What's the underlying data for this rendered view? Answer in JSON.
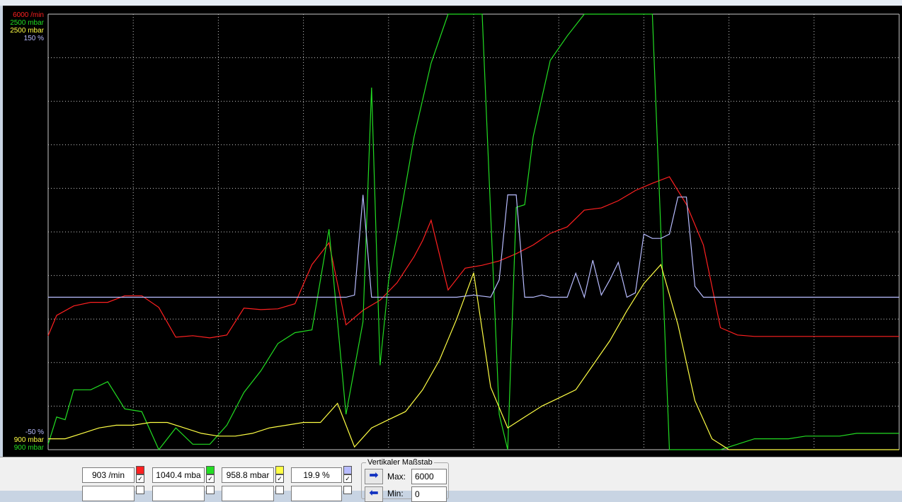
{
  "colors": {
    "rpm": "#ff2020",
    "boost": "#22dd22",
    "pressure2": "#ffff44",
    "percent": "#b8bcff",
    "grid": "#c8c8c8",
    "background": "#000000"
  },
  "scale_labels": {
    "top": [
      {
        "text": "6000 /min",
        "color": "#ff2020"
      },
      {
        "text": "2500 mbar",
        "color": "#22dd22"
      },
      {
        "text": "2500 mbar",
        "color": "#ffff44"
      },
      {
        "text": "150 %",
        "color": "#b8bcff"
      }
    ],
    "bottom": [
      {
        "text": "-50 %",
        "color": "#b8bcff"
      },
      {
        "text": "900 mbar",
        "color": "#ffff44"
      },
      {
        "text": "900 mbar",
        "color": "#22dd22"
      }
    ]
  },
  "channels": [
    {
      "value": "903 /min",
      "color": "#ff2020",
      "checked": "✓"
    },
    {
      "value": "1040.4 mba",
      "color": "#22dd22",
      "checked": "✓"
    },
    {
      "value": "958.8 mbar",
      "color": "#ffff44",
      "checked": "✓"
    },
    {
      "value": "19.9 %",
      "color": "#b8bcff",
      "checked": "✓"
    }
  ],
  "vertical_scale": {
    "title": "Vertikaler Maßstab",
    "max_label": "Max:",
    "max_value": "6000",
    "min_label": "Min:",
    "min_value": "0"
  },
  "chart_data": {
    "type": "line",
    "grid": true,
    "xlim": [
      0,
      100
    ],
    "series": [
      {
        "color": "#ff2020",
        "ylim": [
          0,
          6000
        ],
        "x": [
          0,
          1,
          3,
          5,
          7,
          9,
          11,
          13,
          15,
          17,
          19,
          21,
          23,
          25,
          27,
          29,
          31,
          33,
          35,
          37,
          39,
          41,
          42,
          43,
          44,
          45,
          47,
          49,
          51,
          53,
          55,
          57,
          59,
          61,
          63,
          65,
          67,
          69,
          71,
          73,
          75,
          77,
          79,
          81,
          83,
          85,
          87,
          89,
          91,
          93,
          95,
          97,
          99,
          100
        ],
        "y": [
          1570,
          1850,
          1980,
          2030,
          2030,
          2120,
          2120,
          1960,
          1550,
          1570,
          1540,
          1580,
          1950,
          1930,
          1940,
          2010,
          2550,
          2850,
          1720,
          1920,
          2060,
          2300,
          2480,
          2660,
          2880,
          3160,
          2200,
          2500,
          2540,
          2600,
          2700,
          2820,
          2980,
          3070,
          3300,
          3330,
          3430,
          3570,
          3670,
          3760,
          3380,
          2820,
          1680,
          1580,
          1560,
          1560,
          1560,
          1560,
          1560,
          1560,
          1560,
          1560,
          1560,
          1560
        ]
      },
      {
        "color": "#22dd22",
        "ylim": [
          900,
          2500
        ],
        "x": [
          0,
          1,
          2,
          3,
          5,
          7,
          9,
          11,
          13,
          15,
          17,
          18,
          19,
          21,
          23,
          25,
          27,
          29,
          31,
          33,
          35,
          37,
          38,
          39,
          40,
          41,
          43,
          45,
          47,
          49,
          51,
          53,
          54,
          55,
          56,
          57,
          59,
          61,
          63,
          65,
          67,
          69,
          71,
          73,
          75,
          77,
          79,
          81,
          83,
          85,
          87,
          89,
          91,
          93,
          95,
          97,
          99,
          100
        ],
        "y": [
          920,
          1020,
          1010,
          1120,
          1120,
          1150,
          1050,
          1040,
          890,
          980,
          920,
          920,
          920,
          990,
          1110,
          1190,
          1290,
          1330,
          1340,
          1710,
          1030,
          1370,
          2230,
          1210,
          1520,
          1690,
          2050,
          2320,
          2600,
          2820,
          2830,
          1030,
          880,
          1790,
          1800,
          2050,
          2330,
          2420,
          2580,
          2700,
          2810,
          2870,
          2500,
          900,
          900,
          900,
          890,
          920,
          940,
          940,
          940,
          950,
          950,
          950,
          960,
          960,
          960,
          960
        ]
      },
      {
        "color": "#ffff44",
        "ylim": [
          900,
          2500
        ],
        "x": [
          0,
          2,
          4,
          6,
          8,
          10,
          12,
          14,
          16,
          18,
          20,
          22,
          24,
          26,
          28,
          30,
          32,
          34,
          36,
          38,
          40,
          42,
          44,
          46,
          48,
          50,
          52,
          54,
          56,
          58,
          60,
          62,
          64,
          66,
          68,
          70,
          72,
          74,
          76,
          78,
          80,
          82,
          84,
          86,
          88,
          90,
          92,
          94,
          96,
          98,
          100
        ],
        "y": [
          940,
          940,
          960,
          980,
          990,
          990,
          1000,
          1000,
          980,
          960,
          950,
          950,
          960,
          980,
          990,
          1000,
          1000,
          1070,
          910,
          980,
          1010,
          1040,
          1120,
          1230,
          1380,
          1550,
          1130,
          980,
          1020,
          1060,
          1090,
          1120,
          1210,
          1300,
          1410,
          1510,
          1580,
          1360,
          1080,
          940,
          900,
          900,
          900,
          900,
          900,
          900,
          900,
          900,
          900,
          900,
          900
        ]
      },
      {
        "color": "#b8bcff",
        "ylim": [
          -50,
          150
        ],
        "x": [
          0,
          5,
          10,
          15,
          20,
          25,
          30,
          35,
          36,
          37,
          38,
          40,
          42,
          45,
          48,
          50,
          52,
          53,
          54,
          55,
          56,
          57,
          58,
          59,
          60,
          61,
          62,
          63,
          64,
          65,
          66,
          67,
          68,
          69,
          70,
          71,
          72,
          73,
          74,
          75,
          76,
          77,
          78,
          79,
          80,
          100
        ],
        "y": [
          20,
          20,
          20,
          20,
          20,
          20,
          20,
          20,
          21,
          67,
          20,
          20,
          20,
          20,
          20,
          21,
          20,
          28,
          67,
          67,
          20,
          20,
          21,
          20,
          20,
          20,
          31,
          20,
          37,
          21,
          28,
          36,
          20,
          22,
          49,
          47,
          47,
          49,
          66,
          66,
          25,
          20,
          20,
          20,
          20,
          20
        ]
      }
    ]
  }
}
